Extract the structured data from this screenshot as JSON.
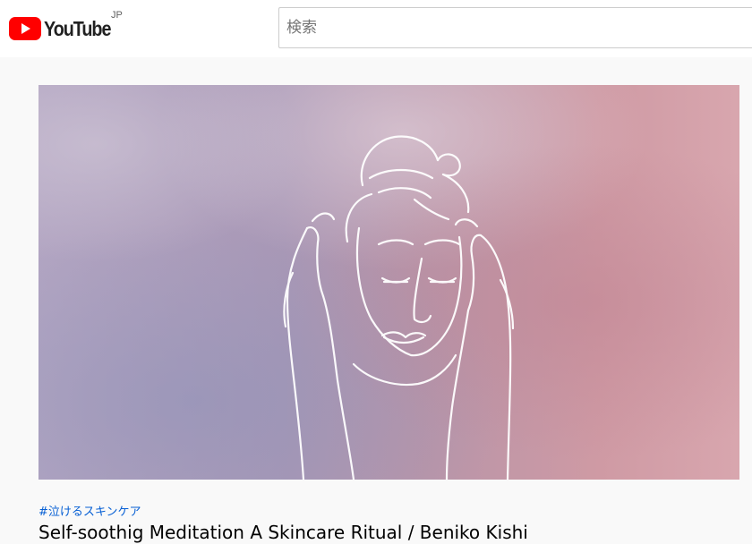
{
  "header": {
    "logo_text": "YouTube",
    "region": "JP",
    "search": {
      "placeholder": "検索",
      "value": ""
    }
  },
  "video": {
    "thumbnail_icon": "line-drawing-woman-meditating",
    "hashtag": "#泣けるスキンケア",
    "title": "Self-soothig Meditation A Skincare Ritual / Beniko Kishi"
  },
  "colors": {
    "brand_red": "#ff0000",
    "link_blue": "#065fd4",
    "thumb_left": "#a99ab8",
    "thumb_right": "#c98f9a"
  }
}
